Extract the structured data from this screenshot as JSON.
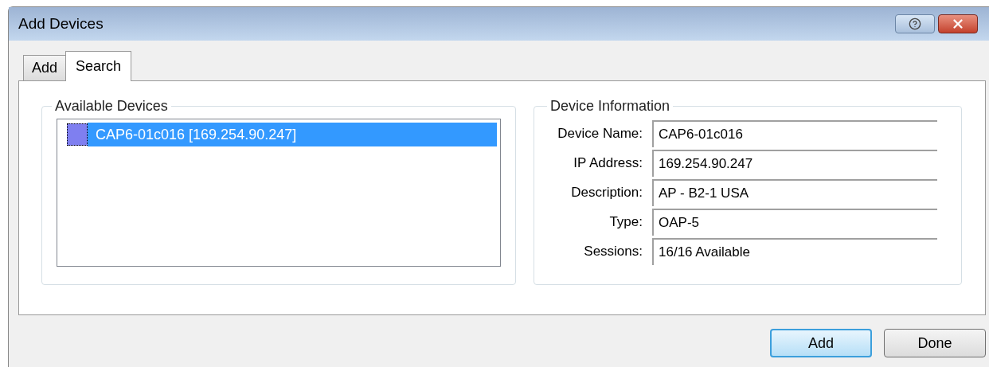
{
  "window": {
    "title": "Add Devices"
  },
  "tabs": [
    {
      "label": "Add",
      "selected": false
    },
    {
      "label": "Search",
      "selected": true
    }
  ],
  "available_devices": {
    "title": "Available Devices",
    "items": [
      {
        "label": "CAP6-01c016 [169.254.90.247]",
        "selected": true
      }
    ]
  },
  "device_information": {
    "title": "Device Information",
    "fields": [
      {
        "label": "Device Name:",
        "value": "CAP6-01c016"
      },
      {
        "label": "IP Address:",
        "value": "169.254.90.247"
      },
      {
        "label": "Description:",
        "value": "AP - B2-1 USA"
      },
      {
        "label": "Type:",
        "value": "OAP-5"
      },
      {
        "label": "Sessions:",
        "value": "16/16 Available"
      }
    ]
  },
  "buttons": [
    {
      "label": "Add",
      "default": true
    },
    {
      "label": "Done",
      "default": false
    }
  ]
}
